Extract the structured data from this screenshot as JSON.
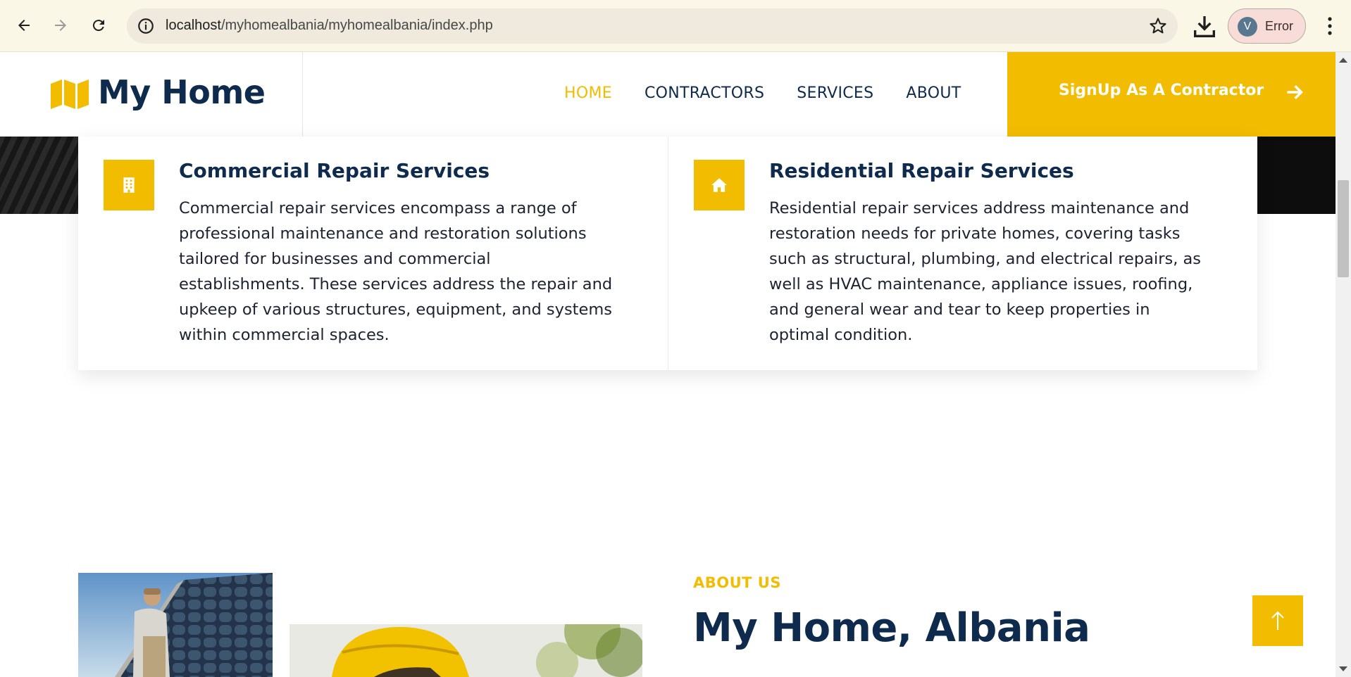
{
  "browser": {
    "url_host": "localhost",
    "url_path": "/myhomealbania/myhomealbania/index.php",
    "profile_initial": "V",
    "profile_status": "Error"
  },
  "header": {
    "brand": "My Home",
    "menu": [
      "HOME",
      "CONTRACTORS",
      "SERVICES",
      "ABOUT"
    ],
    "active_item": "HOME",
    "cta_label": "SignUp As A Contractor"
  },
  "services": [
    {
      "icon": "building-icon",
      "title": "Commercial Repair Services",
      "lines": [
        "Commercial repair services encompass a range of",
        "professional maintenance and restoration solutions",
        "tailored for businesses and commercial",
        "establishments. These services address the repair and",
        "upkeep of various structures, equipment, and systems",
        "within commercial spaces."
      ]
    },
    {
      "icon": "home-icon",
      "title": "Residential Repair Services",
      "lines": [
        "Residential repair services address maintenance and",
        "restoration needs for private homes, covering tasks",
        "such as structural, plumbing, and electrical repairs, as",
        "well as HVAC maintenance, appliance issues, roofing,",
        "and general wear and tear to keep properties in",
        "optimal condition."
      ]
    }
  ],
  "about": {
    "kicker": "ABOUT US",
    "title": "My Home, Albania"
  },
  "colors": {
    "accent": "#f2bc00",
    "navy": "#0e2a4d"
  }
}
